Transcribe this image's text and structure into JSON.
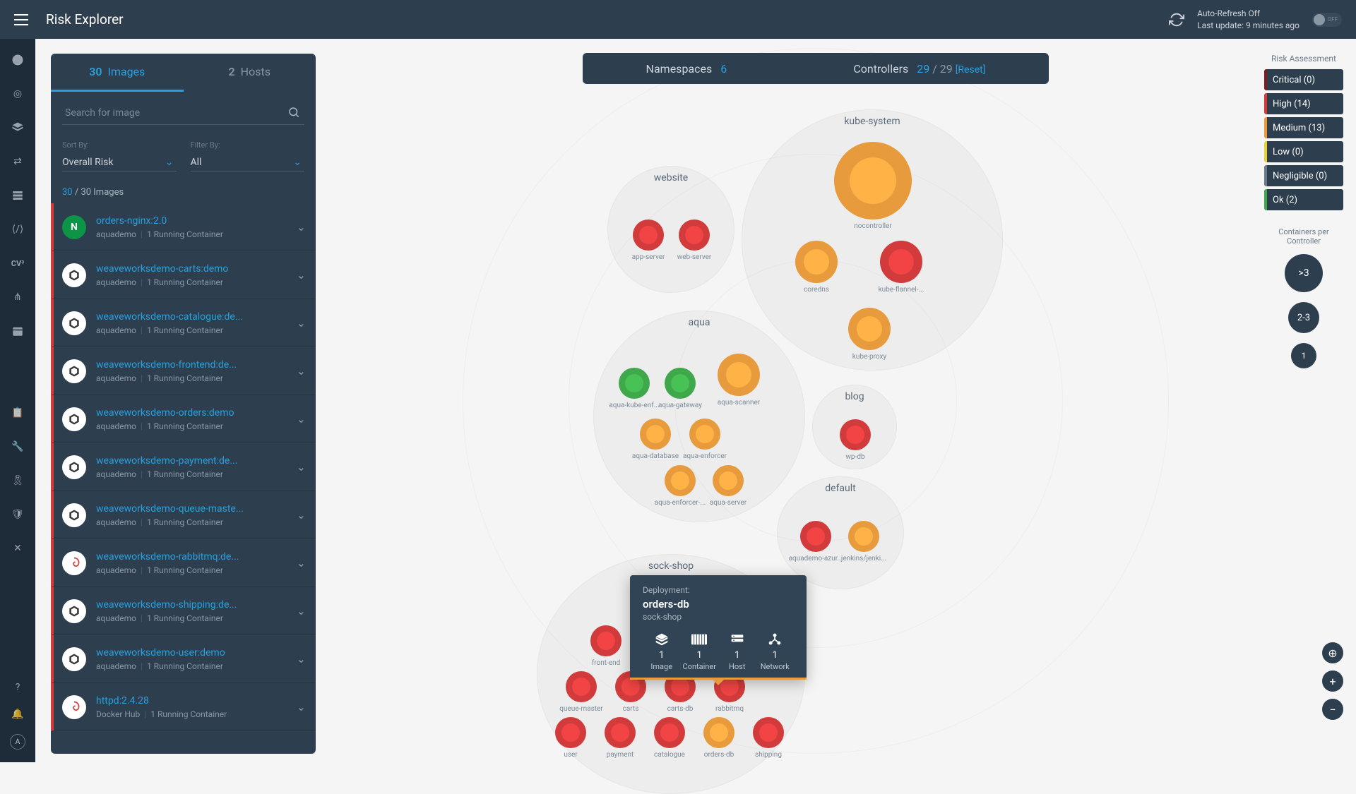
{
  "header": {
    "title": "Risk Explorer",
    "autoRefresh": "Auto-Refresh Off",
    "lastUpdate": "Last update: 9 minutes ago",
    "toggleLabel": "OFF"
  },
  "sidebar": {
    "tabs": {
      "images": {
        "count": "30",
        "label": "Images"
      },
      "hosts": {
        "count": "2",
        "label": "Hosts"
      }
    },
    "searchPlaceholder": "Search for image",
    "sortByLabel": "Sort By:",
    "sortByValue": "Overall Risk",
    "filterByLabel": "Filter By:",
    "filterByValue": "All",
    "countCurrent": "30",
    "countTotal": " / 30 Images",
    "items": [
      {
        "name": "orders-nginx:2.0",
        "registry": "aquademo",
        "running": "1 Running Container",
        "icon": "nginx"
      },
      {
        "name": "weaveworksdemo-carts:demo",
        "registry": "aquademo",
        "running": "1 Running Container",
        "icon": "weave"
      },
      {
        "name": "weaveworksdemo-catalogue:de...",
        "registry": "aquademo",
        "running": "1 Running Container",
        "icon": "weave"
      },
      {
        "name": "weaveworksdemo-frontend:de...",
        "registry": "aquademo",
        "running": "1 Running Container",
        "icon": "weave"
      },
      {
        "name": "weaveworksdemo-orders:demo",
        "registry": "aquademo",
        "running": "1 Running Container",
        "icon": "weave"
      },
      {
        "name": "weaveworksdemo-payment:de...",
        "registry": "aquademo",
        "running": "1 Running Container",
        "icon": "weave"
      },
      {
        "name": "weaveworksdemo-queue-maste...",
        "registry": "aquademo",
        "running": "1 Running Container",
        "icon": "weave"
      },
      {
        "name": "weaveworksdemo-rabbitmq:de...",
        "registry": "aquademo",
        "running": "1 Running Container",
        "icon": "debian"
      },
      {
        "name": "weaveworksdemo-shipping:de...",
        "registry": "aquademo",
        "running": "1 Running Container",
        "icon": "weave"
      },
      {
        "name": "weaveworksdemo-user:demo",
        "registry": "aquademo",
        "running": "1 Running Container",
        "icon": "weave"
      },
      {
        "name": "httpd:2.4.28",
        "registry": "Docker Hub",
        "running": "1 Running Container",
        "icon": "debian"
      }
    ]
  },
  "topPill": {
    "namespacesLabel": "Namespaces",
    "namespacesCount": "6",
    "controllersLabel": "Controllers",
    "controllersCurrent": "29",
    "controllersTotal": "/ 29",
    "reset": "[Reset]"
  },
  "clusters": {
    "website": {
      "title": "website",
      "nodes": [
        {
          "label": "app-server",
          "risk": "red"
        },
        {
          "label": "web-server",
          "risk": "red"
        }
      ]
    },
    "kubeSystem": {
      "title": "kube-system",
      "nodes": [
        {
          "label": "nocontroller",
          "risk": "orange",
          "size": "big"
        },
        {
          "label": "coredns",
          "risk": "orange",
          "size": "med"
        },
        {
          "label": "kube-flannel-...",
          "risk": "red",
          "size": "med"
        },
        {
          "label": "kube-proxy",
          "risk": "orange",
          "size": "med"
        }
      ]
    },
    "aqua": {
      "title": "aqua",
      "nodes": [
        {
          "label": "aqua-kube-enf...",
          "risk": "green"
        },
        {
          "label": "aqua-gateway",
          "risk": "green"
        },
        {
          "label": "aqua-scanner",
          "risk": "orange",
          "size": "med"
        },
        {
          "label": "aqua-database",
          "risk": "orange"
        },
        {
          "label": "aqua-enforcer",
          "risk": "orange"
        },
        {
          "label": "aqua-enforcer-...",
          "risk": "orange"
        },
        {
          "label": "aqua-server",
          "risk": "orange"
        }
      ]
    },
    "blog": {
      "title": "blog",
      "nodes": [
        {
          "label": "wp-db",
          "risk": "red"
        }
      ]
    },
    "default": {
      "title": "default",
      "nodes": [
        {
          "label": "aquademo-azur...",
          "risk": "red"
        },
        {
          "label": "jenkins/jenki...",
          "risk": "orange"
        }
      ]
    },
    "sockShop": {
      "title": "sock-shop",
      "nodes": [
        {
          "label": "front-end",
          "risk": "red"
        },
        {
          "label": "queue-master",
          "risk": "red"
        },
        {
          "label": "carts",
          "risk": "red"
        },
        {
          "label": "carts-db",
          "risk": "red"
        },
        {
          "label": "rabbitmq",
          "risk": "red"
        },
        {
          "label": "user",
          "risk": "red"
        },
        {
          "label": "payment",
          "risk": "red"
        },
        {
          "label": "catalogue",
          "risk": "red"
        },
        {
          "label": "orders-db",
          "risk": "orange"
        },
        {
          "label": "shipping",
          "risk": "red"
        }
      ]
    }
  },
  "tooltip": {
    "type": "Deployment:",
    "name": "orders-db",
    "namespace": "sock-shop",
    "stats": [
      {
        "value": "1",
        "label": "Image"
      },
      {
        "value": "1",
        "label": "Container"
      },
      {
        "value": "1",
        "label": "Host"
      },
      {
        "value": "1",
        "label": "Network"
      }
    ]
  },
  "legend": {
    "title": "Risk Assessment",
    "items": [
      {
        "label": "Critical (0)",
        "cls": "crit"
      },
      {
        "label": "High (14)",
        "cls": "high"
      },
      {
        "label": "Medium (13)",
        "cls": "med"
      },
      {
        "label": "Low (0)",
        "cls": "low"
      },
      {
        "label": "Negligible (0)",
        "cls": "neg"
      },
      {
        "label": "Ok (2)",
        "cls": "ok"
      }
    ],
    "title2": "Containers per Controller",
    "bubbles": [
      ">3",
      "2-3",
      "1"
    ]
  }
}
